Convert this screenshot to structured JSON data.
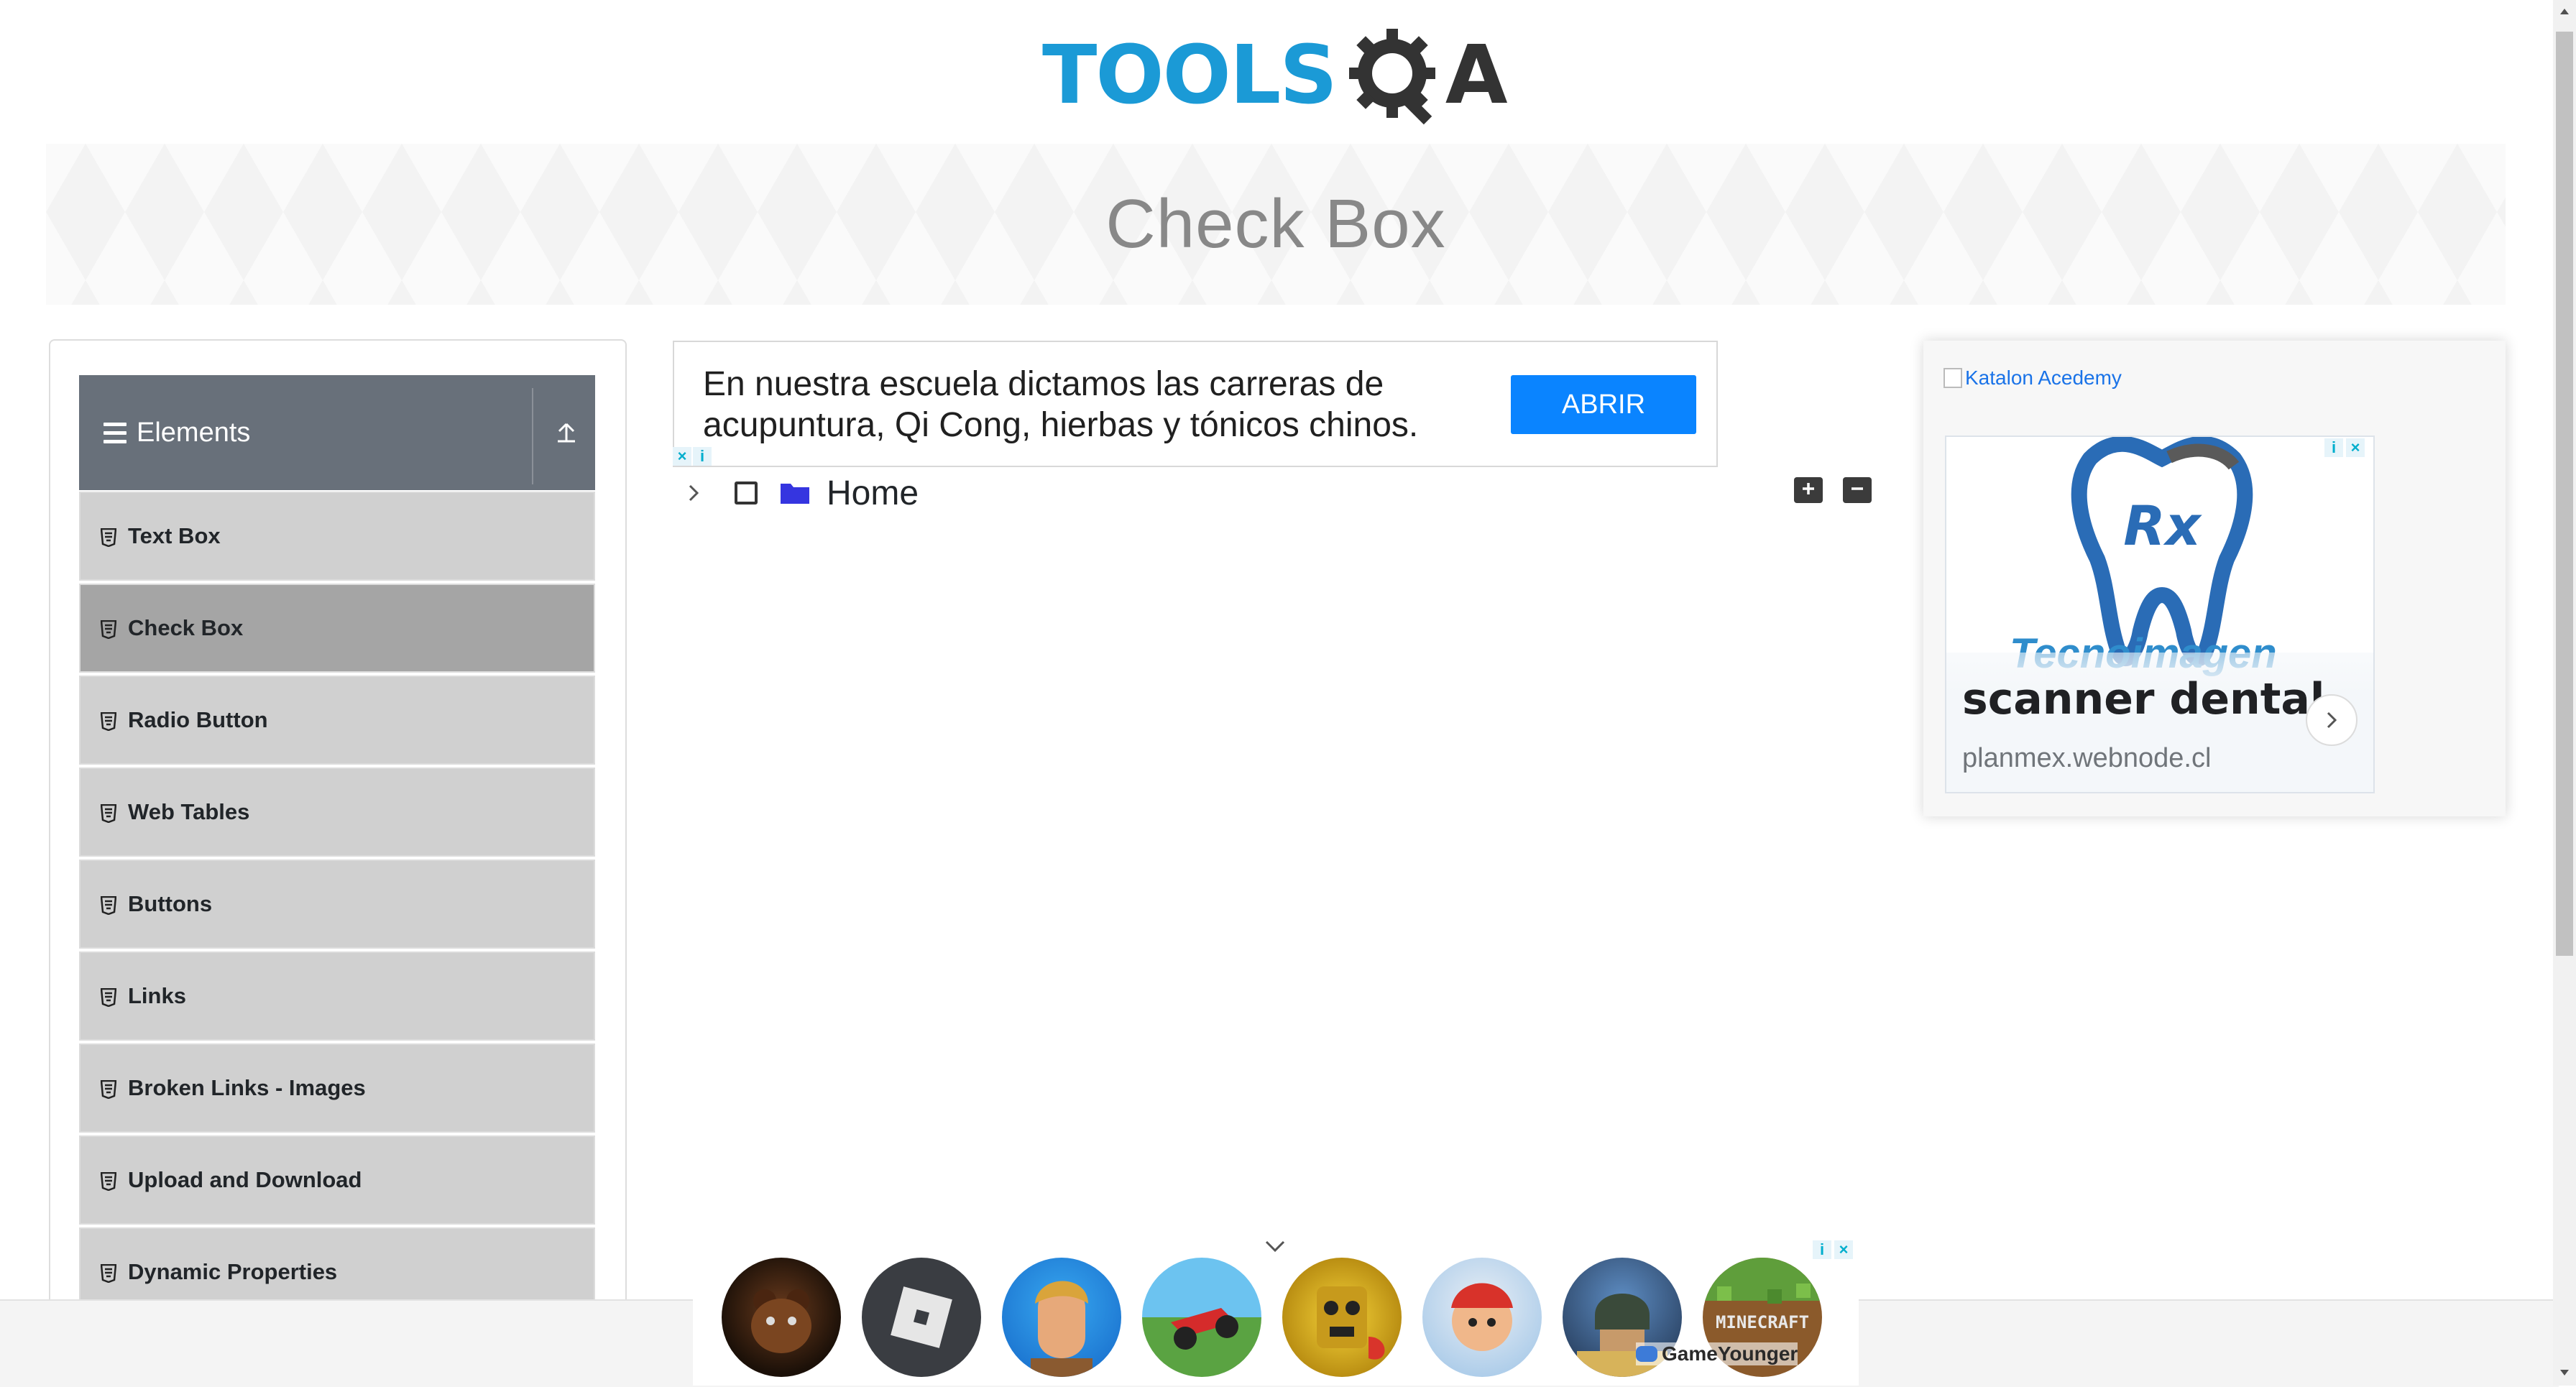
{
  "header": {
    "logo_text": "TOOLS",
    "logo_suffix": "A",
    "page_title": "Check Box"
  },
  "sidebar": {
    "group_label": "Elements",
    "items": [
      {
        "label": "Text Box",
        "active": false
      },
      {
        "label": "Check Box",
        "active": true
      },
      {
        "label": "Radio Button",
        "active": false
      },
      {
        "label": "Web Tables",
        "active": false
      },
      {
        "label": "Buttons",
        "active": false
      },
      {
        "label": "Links",
        "active": false
      },
      {
        "label": "Broken Links - Images",
        "active": false
      },
      {
        "label": "Upload and Download",
        "active": false
      },
      {
        "label": "Dynamic Properties",
        "active": false
      }
    ]
  },
  "top_ad": {
    "text": "En nuestra escuela dictamos las carreras de acupuntura, Qi Cong, hierbas y tónicos chinos.",
    "cta_label": "ABRIR"
  },
  "tree": {
    "root_label": "Home",
    "checked": false,
    "expanded": false
  },
  "right_ad": {
    "alt_text": "Katalon Acedemy",
    "brand_text": "Tecnoimagen",
    "logo_text": "Rx",
    "headline": "scanner dental",
    "url": "planmex.webnode.cl"
  },
  "bottom_ad": {
    "brand": "GameYounger"
  },
  "icons": {
    "menu": "hamburger-icon",
    "collapse_group": "arrow-up-icon",
    "item": "html5-icon",
    "expand_all": "plus-square-icon",
    "collapse_all": "minus-square-icon",
    "tree_toggle": "chevron-right-icon",
    "folder": "folder-icon",
    "ad_info": "info-icon",
    "ad_close": "close-icon"
  },
  "colors": {
    "brand_blue": "#1b9ad6",
    "sidebar_header": "#68707a",
    "menu_item": "#d0d0d0",
    "menu_item_active": "#a5a5a5",
    "cta_blue": "#0a84ff",
    "folder_blue": "#3535e0"
  }
}
